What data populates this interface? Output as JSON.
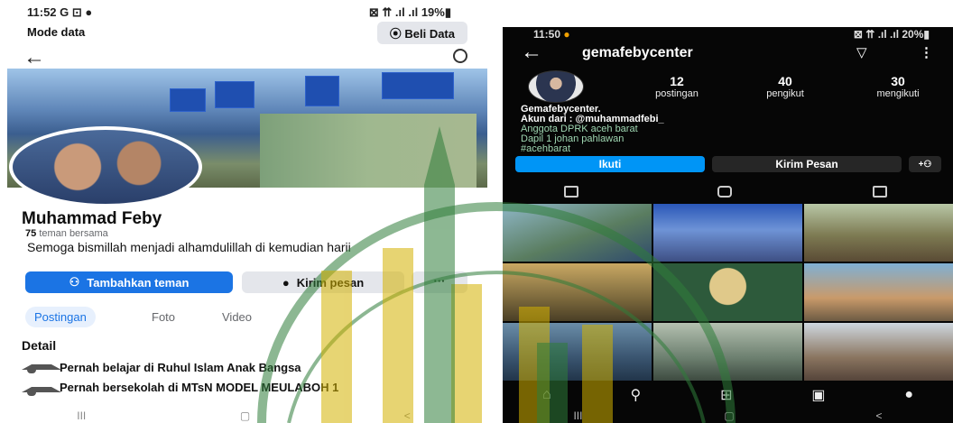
{
  "facebook": {
    "status": {
      "time": "11:52 G ⊡ ●",
      "right": "⊠ ⇈ .ıl .ıl 19%▮"
    },
    "mode_data": "Mode data",
    "beli_data": "Beli Data",
    "name": "Muhammad Feby",
    "friends_count": "75",
    "friends_label": "teman bersama",
    "bio": "Semoga bismillah menjadi alhamdulillah di kemudian harii",
    "btn_add": "Tambahkan teman",
    "btn_msg": "Kirim pesan",
    "btn_more": "···",
    "tabs": [
      "Postingan",
      "Foto",
      "Video"
    ],
    "detail_title": "Detail",
    "detail_items": [
      "Pernah belajar di Ruhul Islam Anak Bangsa",
      "Pernah bersekolah di MTsN MODEL MEULABOH 1"
    ],
    "sysnav": [
      "III",
      "▢",
      "<"
    ]
  },
  "instagram": {
    "status": {
      "time": "11:50",
      "right": "⊠ ⇈ .ıl .ıl 20%▮"
    },
    "username": "gemafebycenter",
    "stats": [
      {
        "num": "12",
        "label": "postingan"
      },
      {
        "num": "40",
        "label": "pengikut"
      },
      {
        "num": "30",
        "label": "mengikuti"
      }
    ],
    "bio_lines": [
      "Gemafebycenter.",
      "Akun dari : @muhammadfebi_"
    ],
    "bio_green": [
      "Anggota DPRK aceh barat",
      "Dapil 1 johan pahlawan",
      "#acehbarat"
    ],
    "btn_follow": "Ikuti",
    "btn_message": "Kirim Pesan",
    "btn_add_person": "+⚇",
    "sysnav": [
      "III",
      "▢",
      "<"
    ]
  },
  "colors": {
    "fb_blue": "#1b74e4",
    "ig_blue": "#0095f6",
    "watermark": "#d4b200",
    "ig_bg": "#060606"
  }
}
